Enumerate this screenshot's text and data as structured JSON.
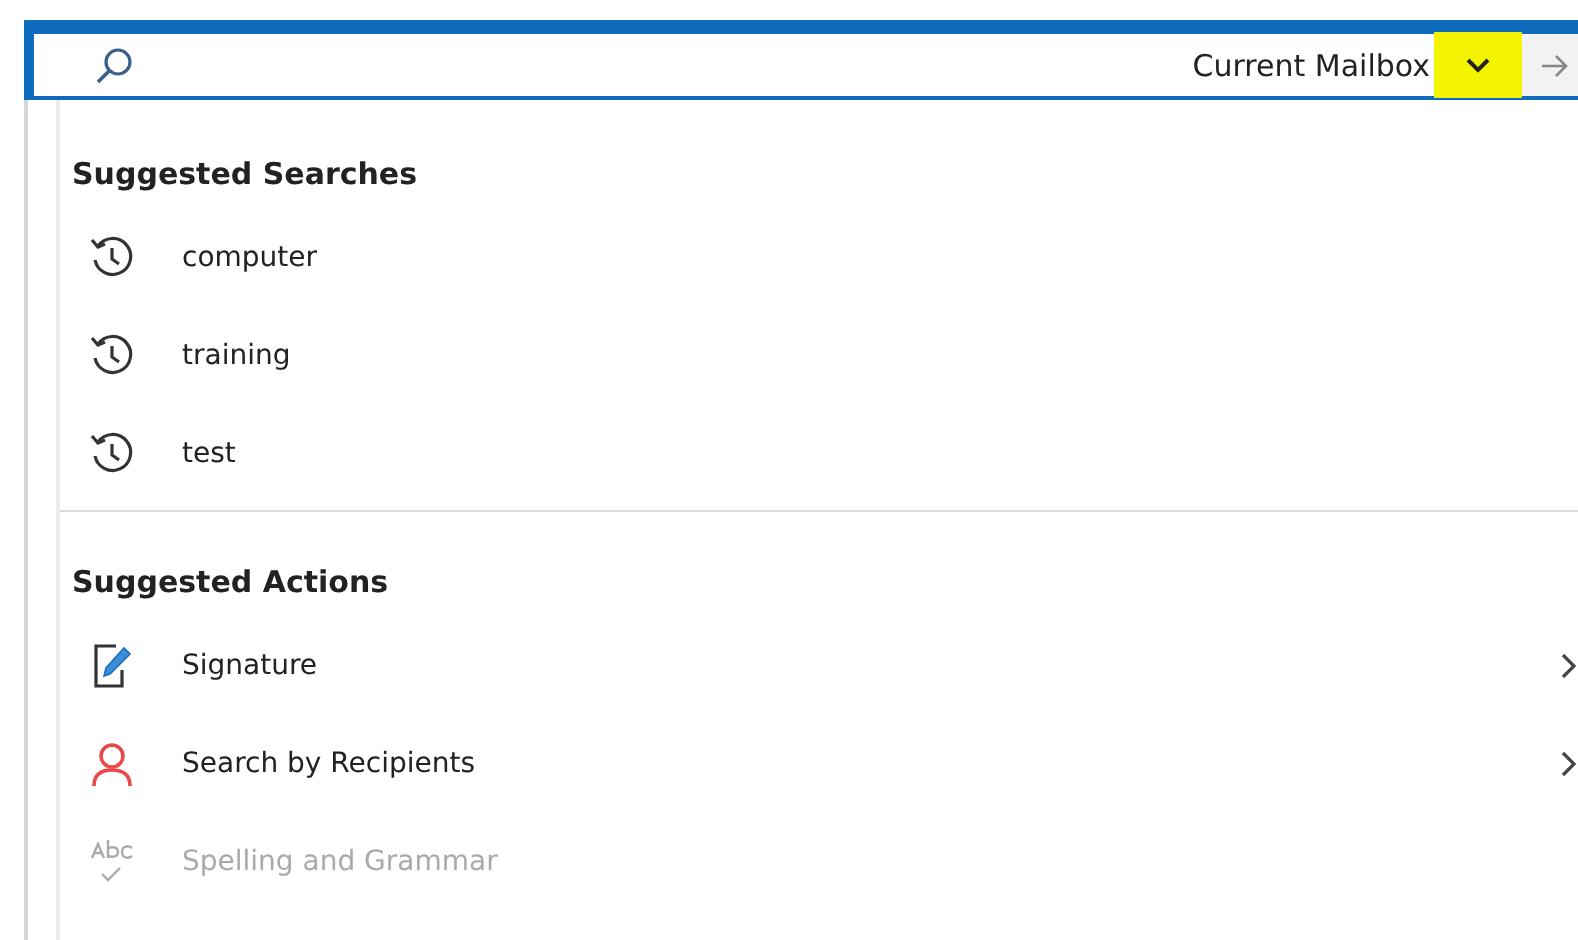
{
  "search_bar": {
    "scope": "Current Mailbox",
    "scope_highlighted": true
  },
  "suggested_searches": {
    "heading": "Suggested Searches",
    "items": [
      {
        "label": "computer"
      },
      {
        "label": "training"
      },
      {
        "label": "test"
      }
    ]
  },
  "suggested_actions": {
    "heading": "Suggested Actions",
    "items": [
      {
        "kind": "signature",
        "label": "Signature",
        "disabled": false,
        "submenu": true
      },
      {
        "kind": "recipients",
        "label": "Search by Recipients",
        "disabled": false,
        "submenu": true
      },
      {
        "kind": "spelling",
        "label": "Spelling and Grammar",
        "disabled": true,
        "submenu": false
      }
    ]
  }
}
